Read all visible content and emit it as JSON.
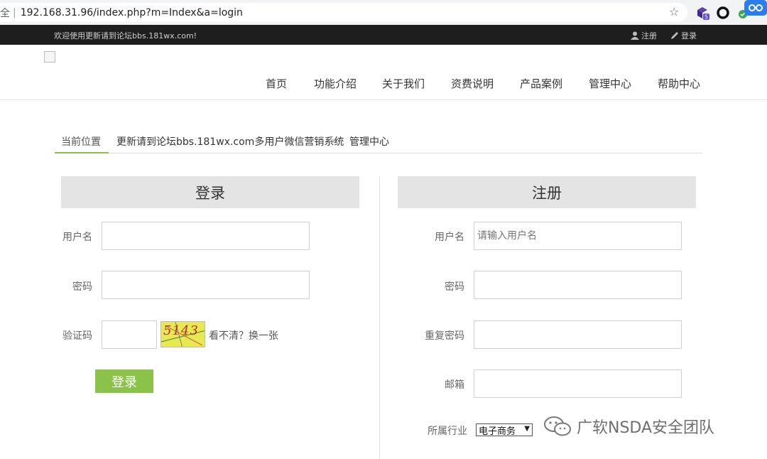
{
  "browser": {
    "url_prefix": "全",
    "url": "192.168.31.96/index.php?m=Index&a=login",
    "ext_badge": "5"
  },
  "topbar": {
    "welcome": "欢迎使用更新请到论坛bbs.181wx.com!",
    "register": "注册",
    "login": "登录"
  },
  "nav": {
    "items": [
      "首页",
      "功能介绍",
      "关于我们",
      "资费说明",
      "产品案例",
      "管理中心",
      "帮助中心"
    ]
  },
  "breadcrumb": {
    "label": "当前位置",
    "site": "更新请到论坛bbs.181wx.com多用户微信营销系统",
    "sep": "»",
    "current": "管理中心"
  },
  "login": {
    "title": "登录",
    "username_label": "用户名",
    "password_label": "密码",
    "captcha_label": "验证码",
    "captcha_text": "5143",
    "refresh_text": "看不清？换一张",
    "submit": "登录"
  },
  "register": {
    "title": "注册",
    "username_label": "用户名",
    "username_placeholder": "请输入用户名",
    "password_label": "密码",
    "repeat_label": "重复密码",
    "email_label": "邮箱",
    "industry_label": "所属行业",
    "industry_value": "电子商务"
  },
  "watermark": "广软NSDA安全团队",
  "colors": {
    "accent": "#8bc34a",
    "topbar": "#1e1e1e",
    "panel_header": "#e4e4e4"
  }
}
